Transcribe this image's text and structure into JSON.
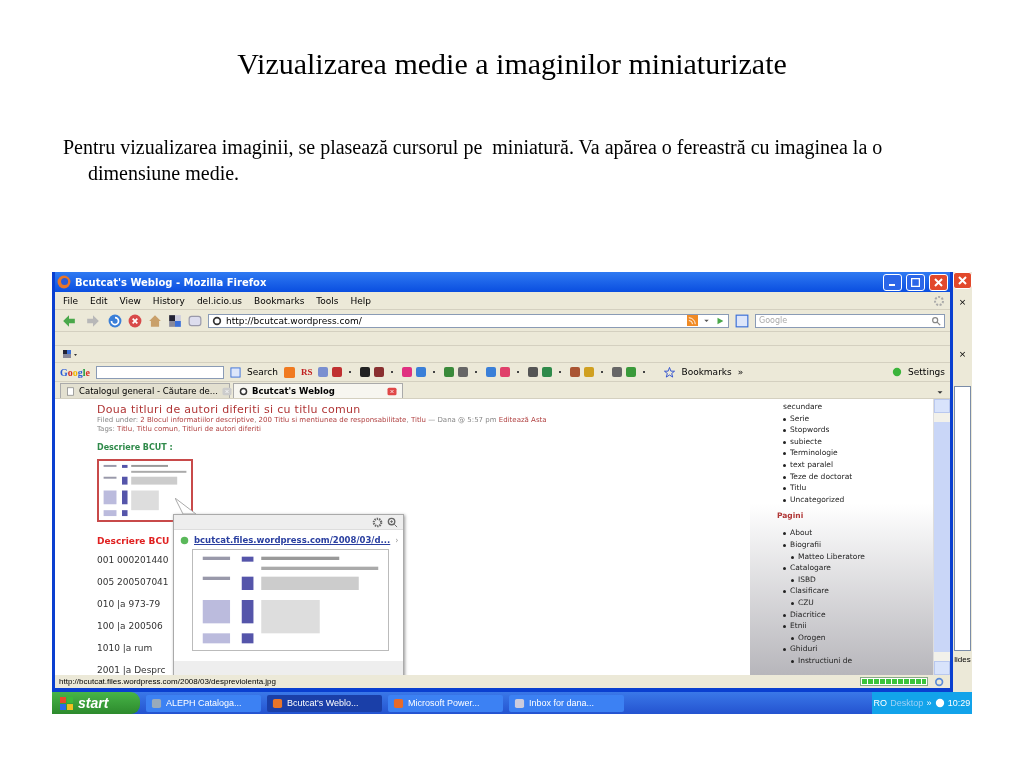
{
  "slide": {
    "title": "Vizualizarea medie a imaginilor miniaturizate",
    "paragraph": "Pentru vizualizarea imaginii, se plasează cursorul pe  miniatură. Va apărea o fereastră cu imaginea la o dimensiune medie."
  },
  "browser": {
    "title": "Bcutcat's Weblog - Mozilla Firefox",
    "menu": [
      "File",
      "Edit",
      "View",
      "History",
      "del.icio.us",
      "Bookmarks",
      "Tools",
      "Help"
    ],
    "address": "http://bcutcat.wordpress.com/",
    "search_placeholder": "Google",
    "google_toolbar": {
      "logo": "Google",
      "search": "Search",
      "rs": "RS",
      "bookmarks": "Bookmarks",
      "more": "»",
      "settings": "Settings"
    },
    "tabs": [
      {
        "label": "Catalogul general - Căutare de...",
        "selected": false
      },
      {
        "label": "Bcutcat's Weblog",
        "selected": true
      }
    ],
    "post": {
      "title": "Doua titluri de autori diferiti si cu titlu comun",
      "separator": ",",
      "filed_label": "Filed under:",
      "categories": [
        "2 Blocul informatiilor descriptive",
        "200 Titlu si mentiunea de responsabilitate",
        "Titlu"
      ],
      "byline": "— Dana @ 5:57 pm",
      "edit": "Editează Asta",
      "tags_label": "Tags:",
      "tags": [
        "Titlu",
        "Titlu comun",
        "Titluri de autori diferiti"
      ],
      "heading": "Descriere BCUT :",
      "heading2": "Descriere BCU",
      "lines": [
        "001 000201440",
        "005 200507041",
        "010 |a 973-79",
        "100 |a 200506",
        "1010 |a rum",
        "2001 |a Desprc"
      ]
    },
    "preview": {
      "link": "bcutcat.files.wordpress.com/2008/03/d...",
      "arrow": "›"
    },
    "sidebar": {
      "cut_line": "secundare",
      "categories": [
        "Serie",
        "Stopwords",
        "subiecte",
        "Terminologie",
        "text paralel",
        "Teze de doctorat",
        "Titlu",
        "Uncategorized"
      ],
      "pages_heading": "Pagini",
      "pages": [
        {
          "label": "About"
        },
        {
          "label": "Biografii",
          "children": [
            {
              "label": "Matteo Liberatore"
            }
          ]
        },
        {
          "label": "Catalogare",
          "children": [
            {
              "label": "ISBD"
            }
          ]
        },
        {
          "label": "Clasificare",
          "children": [
            {
              "label": "CZU"
            }
          ]
        },
        {
          "label": "Diacritice"
        },
        {
          "label": "Etnii",
          "children": [
            {
              "label": "Orogen"
            }
          ]
        },
        {
          "label": "Ghiduri",
          "children": [
            {
              "label": "Instructiuni de"
            }
          ]
        }
      ]
    },
    "status": "http://bcutcat.files.wordpress.com/2008/03/despreviolenta.jpg",
    "progress": {
      "level": 1
    }
  },
  "behind": {
    "close_marks": [
      "×",
      "×"
    ],
    "text": "lides"
  },
  "taskbar": {
    "start": "start",
    "items": [
      {
        "label": "ALEPH Cataloga...",
        "selected": false
      },
      {
        "label": "Bcutcat's Weblo...",
        "selected": true
      },
      {
        "label": "Microsoft Power...",
        "selected": false
      },
      {
        "label": "Inbox for dana...",
        "selected": false
      }
    ],
    "lang": "RO",
    "desktop": "Desktop",
    "chevron": "»",
    "time": "10:29"
  }
}
